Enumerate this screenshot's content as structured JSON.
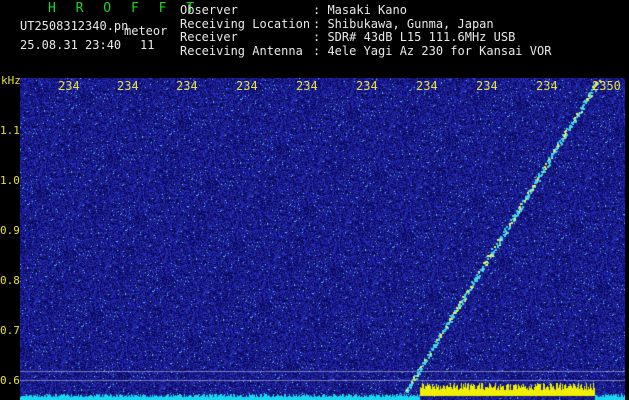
{
  "header": {
    "title": "H R O F F T",
    "filename": "UT2508312340.pn",
    "mode": "meteor",
    "datetime": "25.08.31 23:40",
    "count": "11"
  },
  "info": [
    {
      "label": "Observer",
      "value": ": Masaki Kano"
    },
    {
      "label": "Receiving Location",
      "value": ": Shibukawa, Gunma, Japan"
    },
    {
      "label": "Receiver",
      "value": ": SDR# 43dB L15 111.6MHz USB"
    },
    {
      "label": "Receiving Antenna",
      "value": ": 4ele Yagi Az 230 for Kansai VOR"
    }
  ],
  "axes": {
    "y_unit": "kHz",
    "y_ticks": [
      "1.1",
      "1.0",
      "0.9",
      "0.8",
      "0.7",
      "0.6"
    ],
    "x_ticks": [
      "234",
      "234",
      "234",
      "234",
      "234",
      "234",
      "234",
      "234",
      "234",
      "2350"
    ]
  },
  "colors": {
    "background": "#000000",
    "noise_base": "#14146e",
    "header_green": "#21d321",
    "tick_yellow": "#e8e040",
    "baseline_cyan": "#19d7f0",
    "signal_yellow": "#f0f000"
  }
}
